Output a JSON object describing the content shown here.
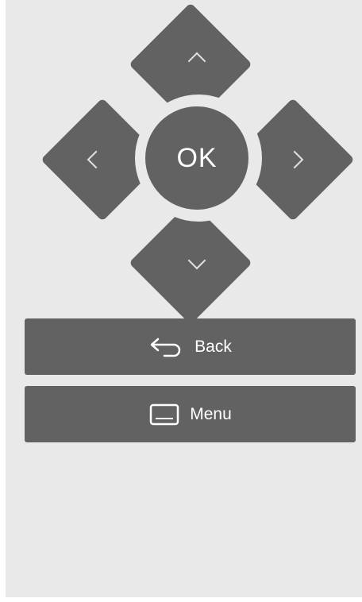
{
  "remote": {
    "ok_label": "OK",
    "back_label": "Back",
    "menu_label": "Menu"
  },
  "icons": {
    "up": "chevron-up-icon",
    "down": "chevron-down-icon",
    "left": "chevron-left-icon",
    "right": "chevron-right-icon",
    "back": "back-arrow-icon",
    "menu": "menu-screen-icon"
  },
  "colors": {
    "background": "#e9e9e9",
    "button": "#626262",
    "text": "#ffffff"
  }
}
